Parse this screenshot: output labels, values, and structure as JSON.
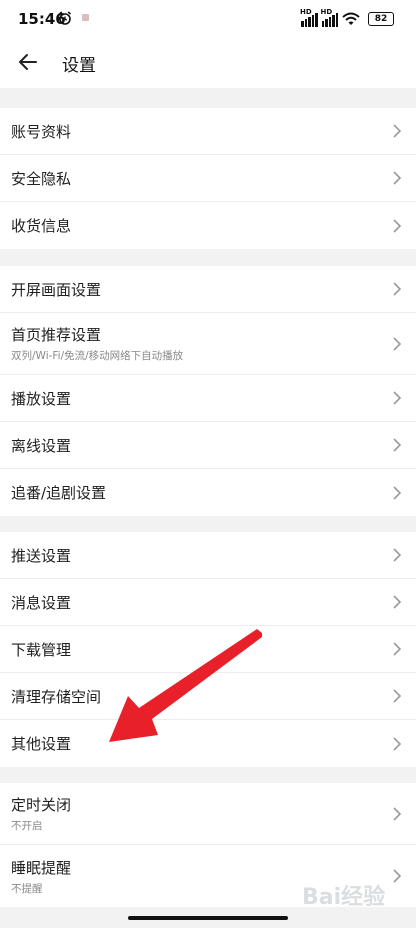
{
  "status_bar": {
    "time": "15:46",
    "sim1": "HD",
    "sim2": "HD",
    "battery": "82"
  },
  "header": {
    "title": "设置"
  },
  "groups": [
    {
      "items": [
        {
          "label": "账号资料"
        },
        {
          "label": "安全隐私"
        },
        {
          "label": "收货信息"
        }
      ]
    },
    {
      "items": [
        {
          "label": "开屏画面设置"
        },
        {
          "label": "首页推荐设置",
          "sub": "双列/Wi-Fi/免流/移动网络下自动播放"
        },
        {
          "label": "播放设置"
        },
        {
          "label": "离线设置"
        },
        {
          "label": "追番/追剧设置"
        }
      ]
    },
    {
      "items": [
        {
          "label": "推送设置"
        },
        {
          "label": "消息设置"
        },
        {
          "label": "下载管理"
        },
        {
          "label": "清理存储空间"
        },
        {
          "label": "其他设置"
        }
      ]
    },
    {
      "items": [
        {
          "label": "定时关闭",
          "sub": "不开启"
        },
        {
          "label": "睡眠提醒",
          "sub": "不提醒"
        }
      ]
    }
  ],
  "annotation": {
    "color": "#e8202a"
  },
  "watermark": {
    "text": "Bai经验"
  }
}
